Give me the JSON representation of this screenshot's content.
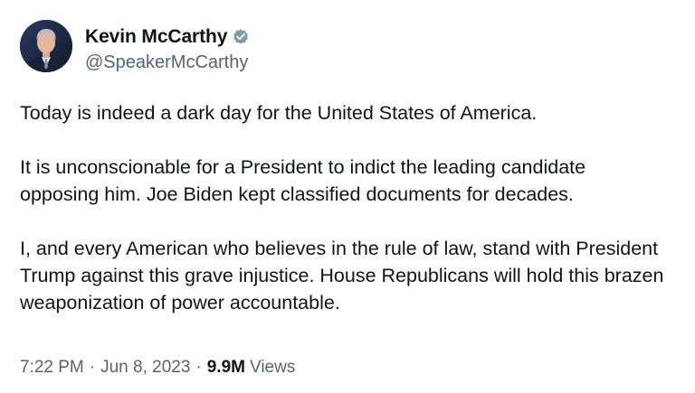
{
  "author": {
    "display_name": "Kevin McCarthy",
    "handle": "@SpeakerMcCarthy",
    "avatar_icon": "profile-photo",
    "verified_icon": "verified-badge-icon",
    "verified_color": "#829aab"
  },
  "tweet": {
    "paragraphs": [
      "Today is indeed a dark day for the United States of America.",
      "It is unconscionable for a President to indict the leading candidate opposing him. Joe Biden kept classified documents for decades.",
      "I, and every American who believes in the rule of law, stand with President Trump against this grave injustice. House Republicans will hold this brazen weaponization of power accountable."
    ]
  },
  "meta": {
    "time": "7:22 PM",
    "separator": "·",
    "date": "Jun 8, 2023",
    "views_count": "9.9M",
    "views_label": "Views"
  },
  "colors": {
    "text_primary": "#0f1419",
    "text_secondary": "#536471"
  }
}
